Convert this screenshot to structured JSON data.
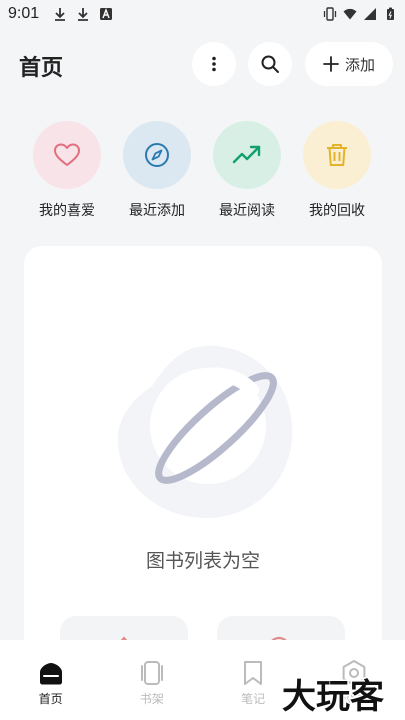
{
  "status_bar": {
    "time": "9:01",
    "icons": [
      "download-icon",
      "download-icon",
      "font-a-icon",
      "vibrate-icon",
      "wifi-icon",
      "signal-icon",
      "battery-icon"
    ]
  },
  "header": {
    "title": "首页",
    "more_icon": "more-vertical-icon",
    "search_icon": "search-icon",
    "add_label": "添加"
  },
  "quick_actions": [
    {
      "label": "我的喜爱",
      "icon": "heart-icon",
      "bg": "#f8e3e8",
      "color": "#e0707f"
    },
    {
      "label": "最近添加",
      "icon": "compass-icon",
      "bg": "#dbe8f1",
      "color": "#2a7ab0"
    },
    {
      "label": "最近阅读",
      "icon": "trending-up-icon",
      "bg": "#d8efe6",
      "color": "#12a070"
    },
    {
      "label": "我的回收",
      "icon": "trash-icon",
      "bg": "#fbefd3",
      "color": "#e3b32a"
    }
  ],
  "main": {
    "empty_text": "图书列表为空",
    "illustration": "planet-icon"
  },
  "bottom_nav": [
    {
      "label": "首页",
      "icon": "home-icon",
      "active": true
    },
    {
      "label": "书架",
      "icon": "bookshelf-icon",
      "active": false
    },
    {
      "label": "笔记",
      "icon": "bookmark-icon",
      "active": false
    },
    {
      "label": "设置",
      "icon": "settings-icon",
      "active": false
    }
  ],
  "watermark": {
    "text": "大玩客"
  },
  "colors": {
    "background": "#f4f5f7",
    "card": "#ffffff",
    "text": "#222222",
    "muted": "#bbbbbb"
  }
}
